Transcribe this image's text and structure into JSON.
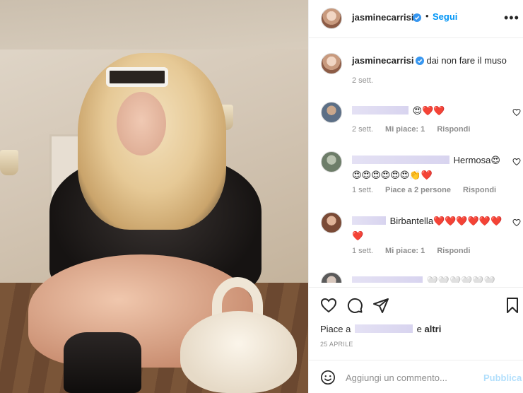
{
  "post": {
    "author": "jasminecarrisi",
    "follow_label": "Segui",
    "separator": "•",
    "more_label": "•••",
    "caption": "dai non fare il muso",
    "caption_time": "2 sett."
  },
  "comments": [
    {
      "text": "😍❤️❤️",
      "time": "2 sett.",
      "likes": "Mi piace: 1",
      "reply": "Rispondi"
    },
    {
      "text": "Hermosa😍😍😍😍😍😍😍👏❤️",
      "time": "1 sett.",
      "likes": "Piace a 2 persone",
      "reply": "Rispondi"
    },
    {
      "text": "Birbantella❤️❤️❤️❤️❤️❤️❤️",
      "time": "1 sett.",
      "likes": "Mi piace: 1",
      "reply": "Rispondi"
    },
    {
      "text": "🤍🤍🤍🤍🤍🤍"
    }
  ],
  "likes_summary": {
    "prefix": "Piace a",
    "conjunction": "e",
    "others": "altri"
  },
  "date": "25 APRILE",
  "composer": {
    "placeholder": "Aggiungi un commento...",
    "publish_label": "Pubblica"
  },
  "icons": {
    "verified": "verified-badge-icon",
    "like": "heart-icon",
    "comment": "comment-icon",
    "share": "paper-plane-icon",
    "save": "bookmark-icon",
    "emoji": "smiley-icon"
  },
  "colors": {
    "link": "#0095f6",
    "publish_disabled": "#b2dffc",
    "secondary_text": "#8e8e8e",
    "redaction": "#e0ddf3"
  }
}
